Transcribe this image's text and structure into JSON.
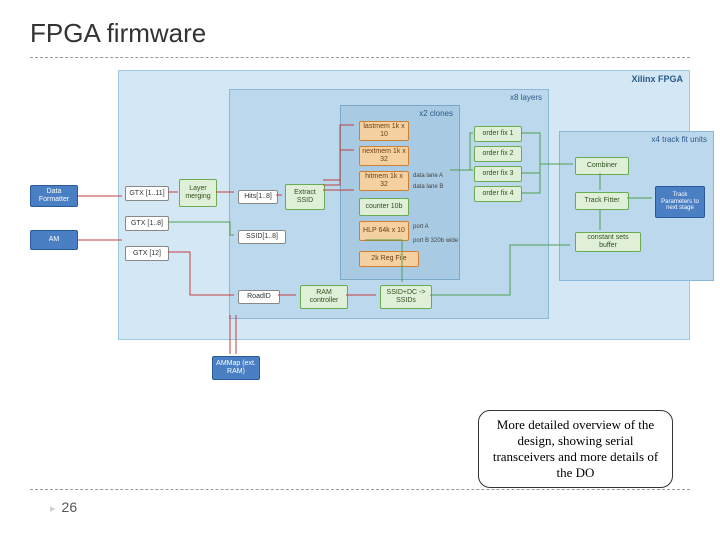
{
  "title": "FPGA firmware",
  "pagenum": "26",
  "callout": "More detailed overview of the design, showing serial transceivers and more details of the DO",
  "regions": {
    "fpga": "Xilinx FPGA",
    "layers": "x8 layers",
    "clones": "x2 clones",
    "fit": "x4 track fit units"
  },
  "blocks": {
    "data_formatter": "Data Formatter",
    "am": "AM",
    "gtx1": "GTX [1..11]",
    "gtx2": "GTX [1..8]",
    "gtx3": "GTX [12]",
    "layer_merging": "Layer merging",
    "hits": "Hits[1..8]",
    "ssid_in": "SSID[1..8]",
    "roadid": "RoadID",
    "extract_ssid": "Extract SSID",
    "ram_ctrl": "RAM controller",
    "ammap": "AMMap (ext. RAM)",
    "lastmem": "lastmem 1k x 10",
    "nextmem": "nextmem 1k x 32",
    "hitmem": "hitmem 1k x 32",
    "counter": "counter 10b",
    "hlp": "HLP 64k x 10",
    "regfile": "2k Reg File",
    "ssid_dc": "SSID+DC -> SSIDs",
    "orderfix1": "order fix 1",
    "orderfix2": "order fix 2",
    "orderfix3": "order fix 3",
    "orderfix4": "order fix 4",
    "combiner": "Combiner",
    "track_fitter": "Track Fitter",
    "const_buf": "constant sets buffer",
    "gtx_out": "GTX [12]",
    "track_params": "Track Parameters to next stage"
  },
  "labels": {
    "lane_a": "data lane A",
    "lane_b": "data lane B",
    "port_a": "port A",
    "port_b": "port B 320b wide"
  }
}
